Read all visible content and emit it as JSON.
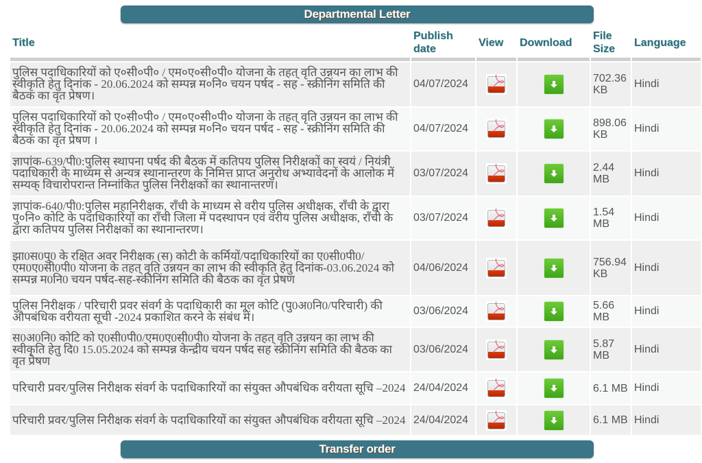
{
  "sections": {
    "departmental_letter": "Departmental Letter",
    "transfer_order": "Transfer order"
  },
  "table": {
    "headers": {
      "title": "Title",
      "publish_date": "Publish date",
      "view": "View",
      "download": "Download",
      "file_size": "File Size",
      "language": "Language"
    },
    "rows": [
      {
        "title": "पुलिस पदाधिकारियों को ए०सी०पी० / एम०ए०सी०पी० योजना के तहत् वृति उन्नयन का लाभ की स्वीकृति हेतु दिनांक - 20.06.2024 को सम्पन्न म०नि० चयन पर्षद - सह - स्क्रीनिंग समिति की बैठक का वृत प्रेषण।",
        "date": "04/07/2024",
        "view_icon": "pdf-icon",
        "download_icon": "download-icon",
        "size": "702.36 KB",
        "language": "Hindi"
      },
      {
        "title": "पुलिस पदाधिकारियों को ए०सी०पी० / एम०ए०सी०पी० योजना के तहत् वृति उन्नयन का लाभ की स्वीकृति हेतु दिनांक - 20.06.2024 को सम्पन्न म०नि० चयन पर्षद - सह - स्क्रीनिंग समिति की बैठक का वृत प्रेषण ।",
        "date": "04/07/2024",
        "view_icon": "pdf-icon",
        "download_icon": "download-icon",
        "size": "898.06 KB",
        "language": "Hindi"
      },
      {
        "title": "ज्ञापांक-639/पी0:पुलिस स्थापना पर्षद की बैठक में कतिपय पुलिस निरीक्षकों का स्वयं / नियंत्री पदाधिकारी के माध्यम से अन्यत्र स्थानान्तरण के निमित्त प्राप्त अनुरोध अभ्यावेदनों के आलोक में सम्यक् विचारोपरान्त निम्नांकित पुलिस निरीक्षकों का स्थानान्तरण।",
        "date": "03/07/2024",
        "view_icon": "pdf-icon",
        "download_icon": "download-icon",
        "size": "2.44 MB",
        "language": "Hindi"
      },
      {
        "title": "ज्ञापांक-640/पी0:पुलिस महानिरीक्षक, राँची के माध्यम से वरीय पुलिस अधीक्षक, राँची के द्वारा पु०नि० कोटि के पदाधिकारियों का राँची जिला में पदस्थापन एवं वरीय पुलिस अधीक्षक, राँची के द्वारा कतिपय पुलिस निरीक्षकों का स्थानान्तरण।",
        "date": "03/07/2024",
        "view_icon": "pdf-icon",
        "download_icon": "download-icon",
        "size": "1.54 MB",
        "language": "Hindi"
      },
      {
        "title": "झा0स0पु0 के रक्षित अवर निरीक्षक (स) कोटी के कर्मियों/पदाधिकारियों का ए0सी0पी0/एम0ए0सी0पी0 योजना के तहत् वृति उन्नयन का लाभ की स्वीकृति हेतु दिनांक-03.06.2024 को सम्पन्न म0नि0 चयन पर्षद-सह-स्कीनिंग समिति की बैठक का वृत प्रेषण",
        "date": "04/06/2024",
        "view_icon": "pdf-icon",
        "download_icon": "download-icon",
        "size": "756.94 KB",
        "language": "Hindi"
      },
      {
        "title": "पुलिस निरीक्षक / परिचारी प्रवर संवर्ग के पदाधिकारी का मूल कोटि (पु0अ0नि0/परिचारी) की औपबंधिक वरीयता सूची -2024 प्रकाशित करने के संबंध में।",
        "date": "03/06/2024",
        "view_icon": "pdf-icon",
        "download_icon": "download-icon",
        "size": "5.66 MB",
        "language": "Hindi"
      },
      {
        "title": "स0अ0नि0 कोटि को ए0सी0पी0/एम0ए0सी0पी0 योजना के तहत् वृति उन्नयन का लाभ की स्वीकृति हेतु दि0 15.05.2024 को सम्पन्न केन्द्रीय चयन पर्षद सह स्क्रीनिंग समिति की बैठक का वृत प्रेषण",
        "date": "03/06/2024",
        "view_icon": "pdf-icon",
        "download_icon": "download-icon",
        "size": "5.87 MB",
        "language": "Hindi"
      },
      {
        "title": "परिचारी प्रवर/पुलिस निरीक्षक संवर्ग के पदाधिकारियों का संयुक्त औपबंधिक वरीयता सूचि –2024",
        "date": "24/04/2024",
        "view_icon": "pdf-icon",
        "download_icon": "download-icon",
        "size": "6.1 MB",
        "language": "Hindi"
      },
      {
        "title": "परिचारी प्रवर/पुलिस निरीक्षक संवर्ग के पदाधिकारियों का संयुक्त औपबंधिक वरीयता सूचि –2024",
        "date": "24/04/2024",
        "view_icon": "pdf-icon",
        "download_icon": "download-icon",
        "size": "6.1 MB",
        "language": "Hindi"
      }
    ]
  },
  "colors": {
    "section_bar": "#3a7688",
    "header_text": "#2a6f7c",
    "row_odd": "#efefef",
    "row_even": "#f7f8f8",
    "download_green": "#4fb526",
    "pdf_red": "#c9320a"
  }
}
